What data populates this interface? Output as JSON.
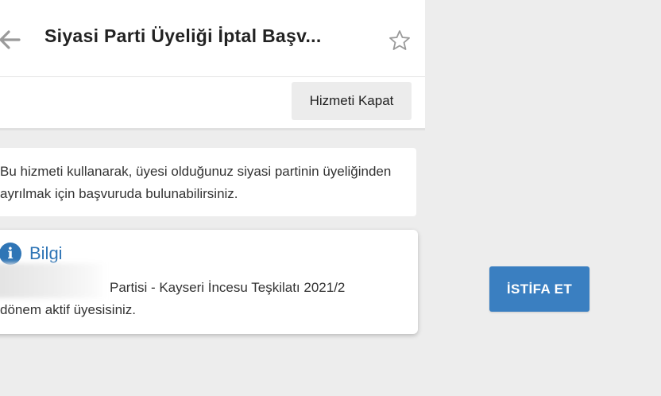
{
  "header": {
    "title": "Siyasi Parti Üyeliği İptal Başv...",
    "back_icon": "arrow-left-icon",
    "favorite_icon": "star-outline-icon"
  },
  "actions": {
    "close_service_label": "Hizmeti Kapat"
  },
  "description": {
    "text": "Bu hizmeti kullanarak, üyesi olduğunuz siyasi partinin üyeliğinden ayrılmak için başvuruda bulunabilirsiniz."
  },
  "info": {
    "icon": "info-icon",
    "icon_glyph": "i",
    "title": "Bilgi",
    "line1": "Partisi - Kayseri İncesu Teşkilatı 2021/2",
    "line2": "dönem aktif üyesisiniz."
  },
  "resign": {
    "label": "İSTİFA ET"
  },
  "colors": {
    "accent": "#2f75b6",
    "button_primary": "#3a7fc1",
    "background": "#ededed",
    "card": "#ffffff"
  }
}
